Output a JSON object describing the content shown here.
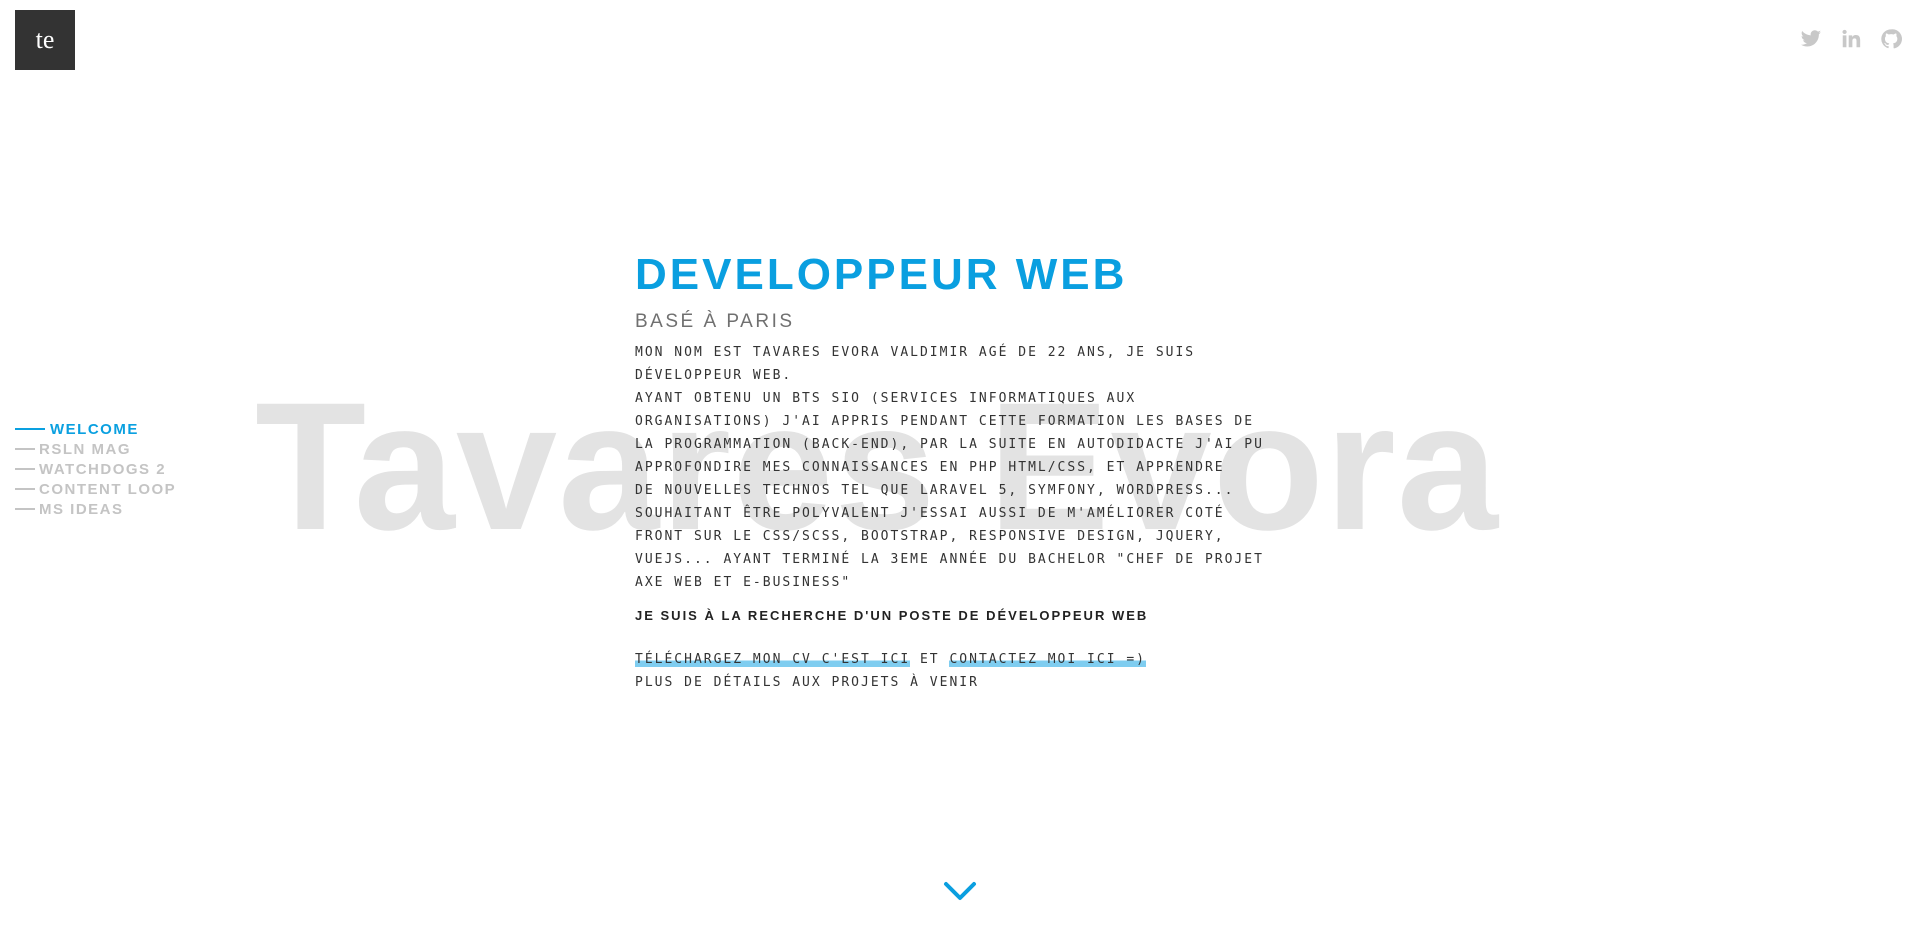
{
  "logo": {
    "text": "te"
  },
  "social": {
    "icons": [
      "twitter-icon",
      "linkedin-icon",
      "github-icon"
    ],
    "color": "#c8c8c8"
  },
  "background_name": "Tavares Evora",
  "sidenav": {
    "items": [
      {
        "label": "WELCOME",
        "active": true
      },
      {
        "label": "RSLN MAG",
        "active": false
      },
      {
        "label": "WATCHDOGS 2",
        "active": false
      },
      {
        "label": "CONTENT LOOP",
        "active": false
      },
      {
        "label": "MS IDEAS",
        "active": false
      }
    ]
  },
  "hero": {
    "title": "DEVELOPPEUR WEB",
    "subtitle": "BASÉ À PARIS",
    "description": "MON NOM EST TAVARES EVORA VALDIMIR AGÉ DE 22 ANS, JE SUIS\nDÉVELOPPEUR WEB.\nAYANT OBTENU UN BTS SIO (SERVICES INFORMATIQUES AUX\nORGANISATIONS) J'AI APPRIS PENDANT CETTE FORMATION LES BASES DE\nLA PROGRAMMATION (BACK-END), PAR LA SUITE EN AUTODIDACTE J'AI PU\nAPPROFONDIRE MES CONNAISSANCES EN PHP HTML/CSS, ET APPRENDRE\nDE NOUVELLES TECHNOS TEL QUE LARAVEL 5, SYMFONY, WORDPRESS...\nSOUHAITANT ÊTRE POLYVALENT J'ESSAI AUSSI DE M'AMÉLIORER COTÉ\nFRONT SUR LE CSS/SCSS, BOOTSTRAP, RESPONSIVE DESIGN, JQUERY,\nVUEJS... AYANT TERMINÉ LA 3EME ANNÉE DU BACHELOR \"CHEF DE PROJET\nAXE WEB ET E-BUSINESS\"",
    "looking": "JE SUIS À LA RECHERCHE D'UN POSTE DE DÉVELOPPEUR WEB",
    "cv_link": "TÉLÉCHARGEZ MON CV C'EST ICI",
    "and_text": "ET",
    "contact_link": "CONTACTEZ MOI ICI =)",
    "more": "PLUS DE DÉTAILS AUX PROJETS À VENIR"
  },
  "scroll": {
    "icon": "chevron-down-icon"
  },
  "colors": {
    "accent": "#0a9fe0",
    "highlight": "#7fcdf0",
    "text": "#333333"
  }
}
